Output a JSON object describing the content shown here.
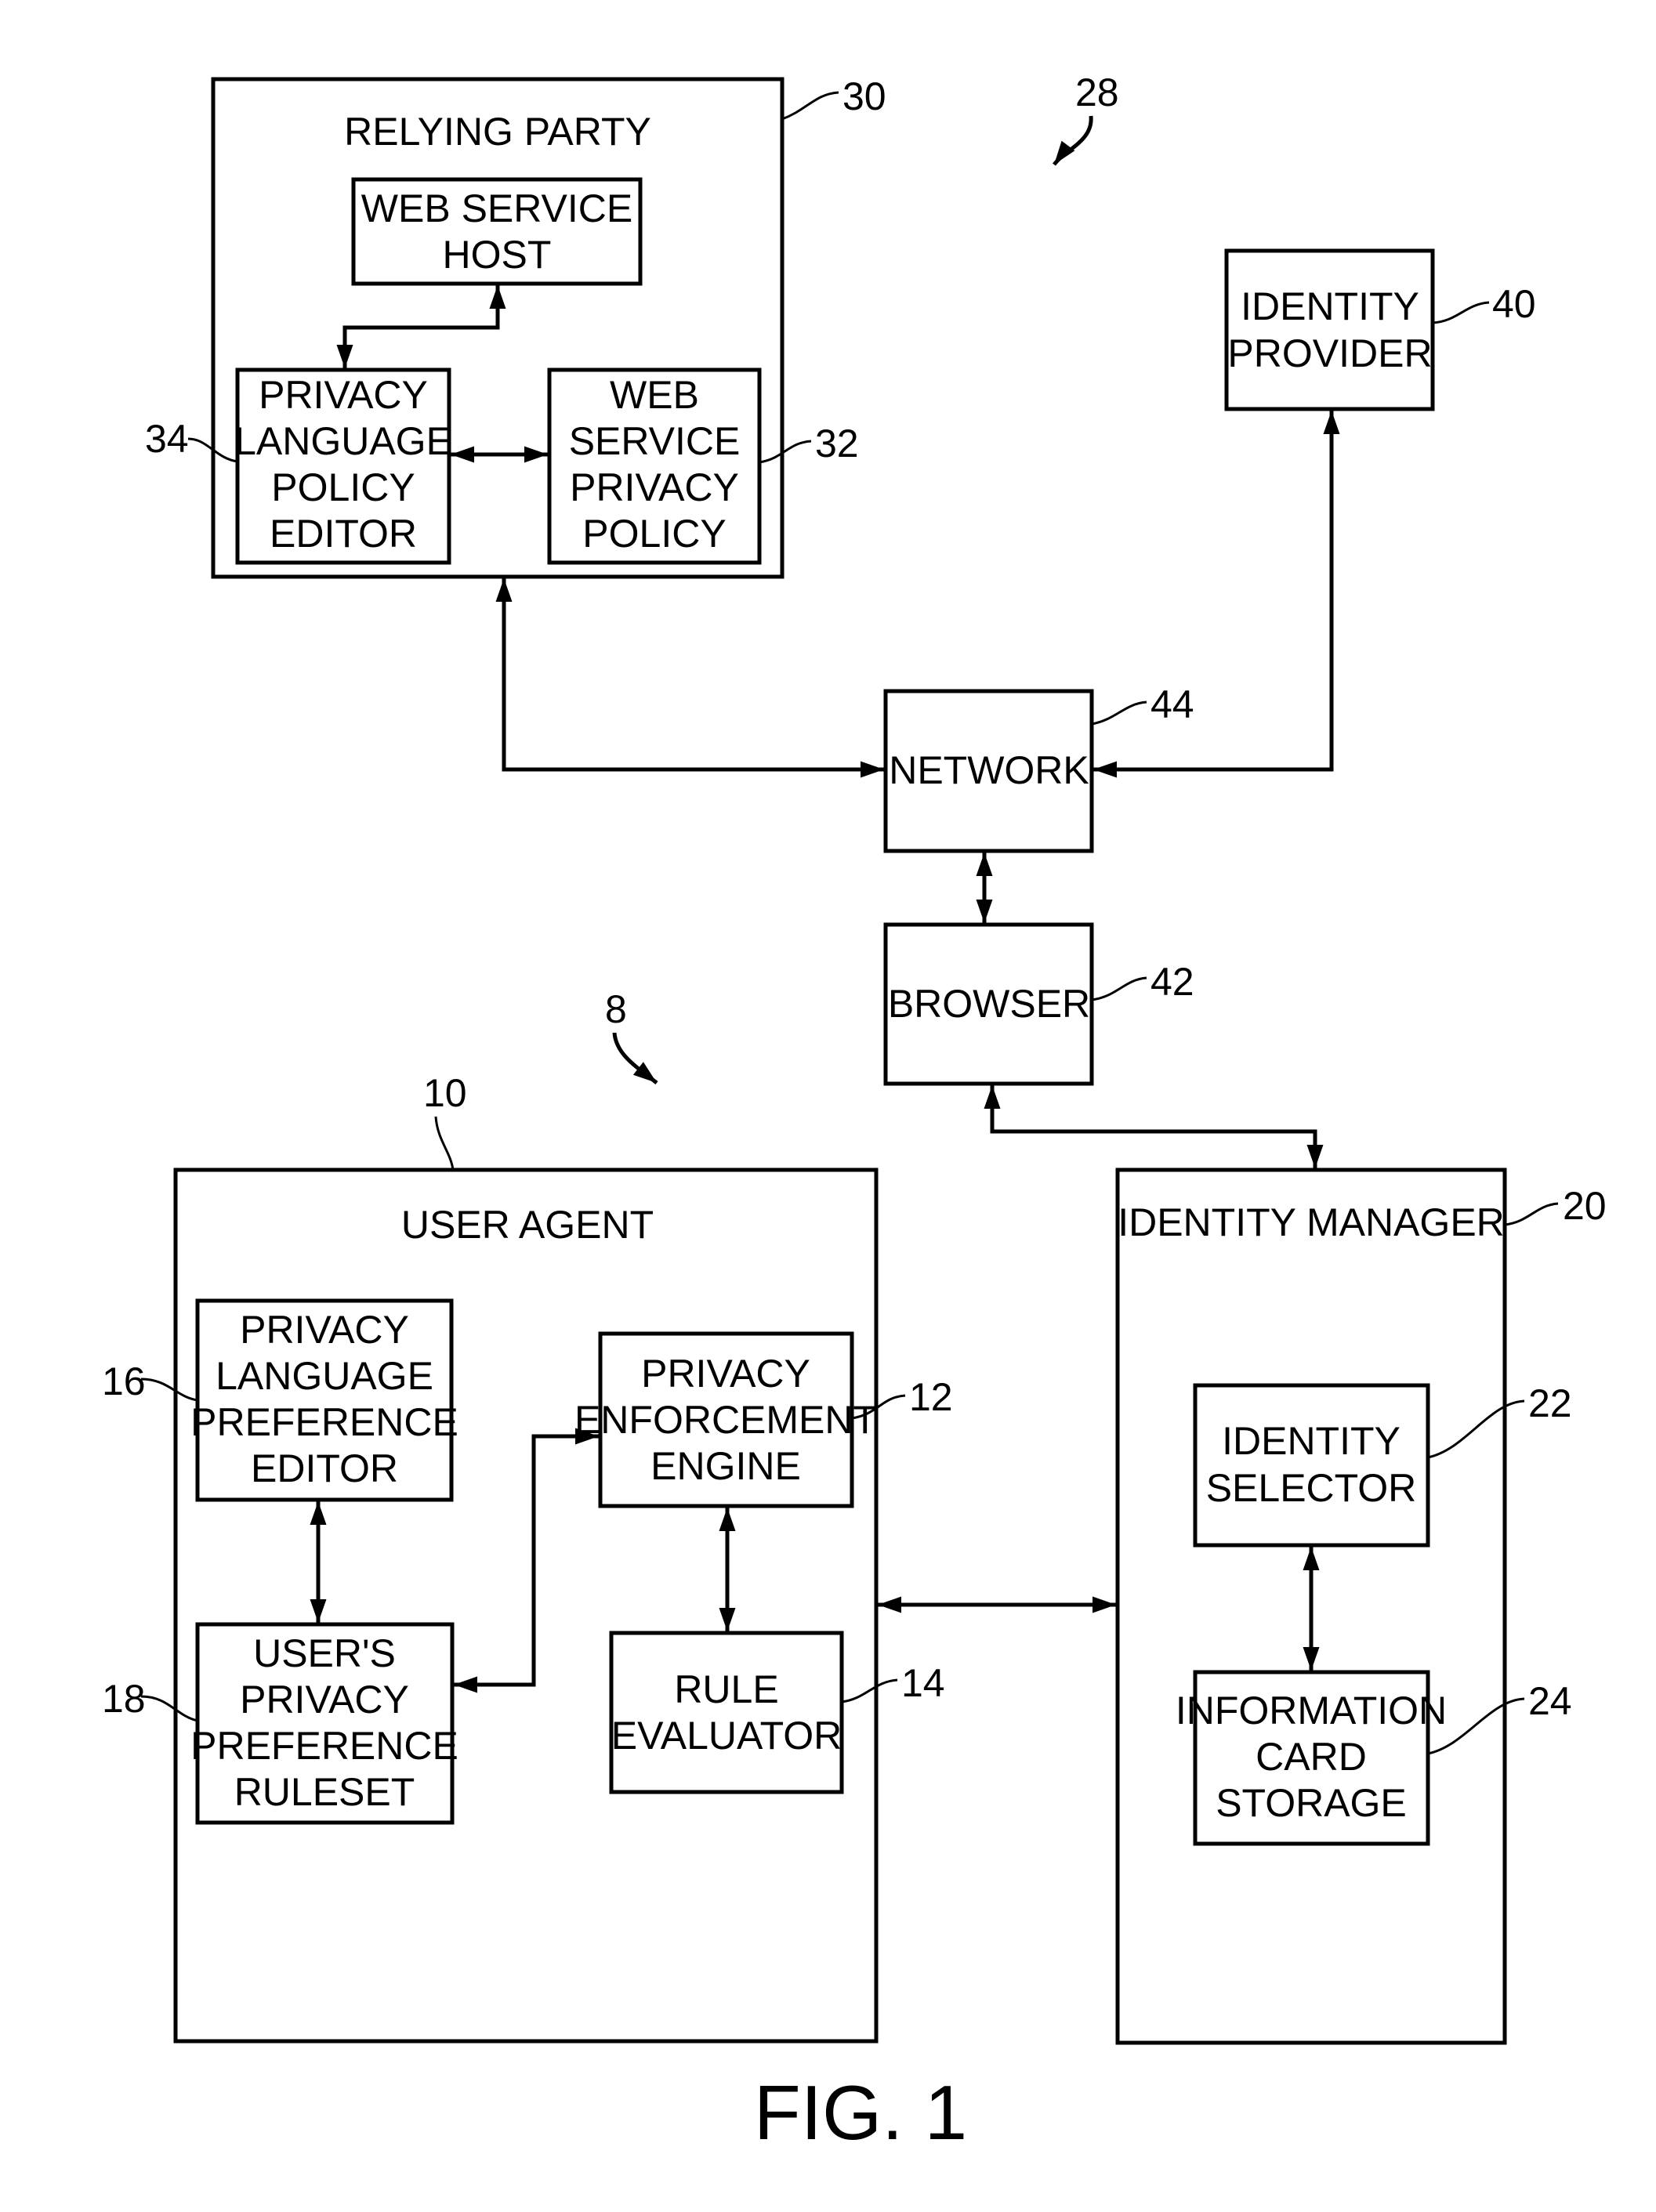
{
  "figure_caption": "FIG. 1",
  "system_refs": {
    "top": "28",
    "bottom": "8"
  },
  "blocks": {
    "relying_party": {
      "title": "RELYING PARTY",
      "ref": "30"
    },
    "web_service_host": {
      "lines": [
        "WEB SERVICE",
        "HOST"
      ]
    },
    "privacy_language_policy_editor": {
      "lines": [
        "PRIVACY",
        "LANGUAGE",
        "POLICY",
        "EDITOR"
      ],
      "ref": "34"
    },
    "web_service_privacy_policy": {
      "lines": [
        "WEB",
        "SERVICE",
        "PRIVACY",
        "POLICY"
      ],
      "ref": "32"
    },
    "identity_provider": {
      "lines": [
        "IDENTITY",
        "PROVIDER"
      ],
      "ref": "40"
    },
    "network": {
      "lines": [
        "NETWORK"
      ],
      "ref": "44"
    },
    "browser": {
      "lines": [
        "BROWSER"
      ],
      "ref": "42"
    },
    "user_agent": {
      "title": "USER AGENT",
      "ref": "10"
    },
    "privacy_language_preference_editor": {
      "lines": [
        "PRIVACY",
        "LANGUAGE",
        "PREFERENCE",
        "EDITOR"
      ],
      "ref": "16"
    },
    "privacy_enforcement_engine": {
      "lines": [
        "PRIVACY",
        "ENFORCEMENT",
        "ENGINE"
      ],
      "ref": "12"
    },
    "users_privacy_preference_ruleset": {
      "lines": [
        "USER'S",
        "PRIVACY",
        "PREFERENCE",
        "RULESET"
      ],
      "ref": "18"
    },
    "rule_evaluator": {
      "lines": [
        "RULE",
        "EVALUATOR"
      ],
      "ref": "14"
    },
    "identity_manager": {
      "title": "IDENTITY MANAGER",
      "ref": "20"
    },
    "identity_selector": {
      "lines": [
        "IDENTITY",
        "SELECTOR"
      ],
      "ref": "22"
    },
    "information_card_storage": {
      "lines": [
        "INFORMATION",
        "CARD",
        "STORAGE"
      ],
      "ref": "24"
    }
  },
  "connections": [
    {
      "from": "web_service_host",
      "to": "privacy_language_policy_editor",
      "type": "bidirectional"
    },
    {
      "from": "privacy_language_policy_editor",
      "to": "web_service_privacy_policy",
      "type": "bidirectional"
    },
    {
      "from": "relying_party",
      "to": "network",
      "type": "bidirectional"
    },
    {
      "from": "identity_provider",
      "to": "network",
      "type": "bidirectional"
    },
    {
      "from": "network",
      "to": "browser",
      "type": "bidirectional"
    },
    {
      "from": "browser",
      "to": "identity_manager",
      "type": "bidirectional"
    },
    {
      "from": "privacy_language_preference_editor",
      "to": "users_privacy_preference_ruleset",
      "type": "bidirectional"
    },
    {
      "from": "users_privacy_preference_ruleset",
      "to": "privacy_enforcement_engine",
      "type": "bidirectional"
    },
    {
      "from": "privacy_enforcement_engine",
      "to": "rule_evaluator",
      "type": "bidirectional"
    },
    {
      "from": "user_agent",
      "to": "identity_manager",
      "type": "bidirectional"
    },
    {
      "from": "identity_selector",
      "to": "information_card_storage",
      "type": "bidirectional"
    }
  ]
}
